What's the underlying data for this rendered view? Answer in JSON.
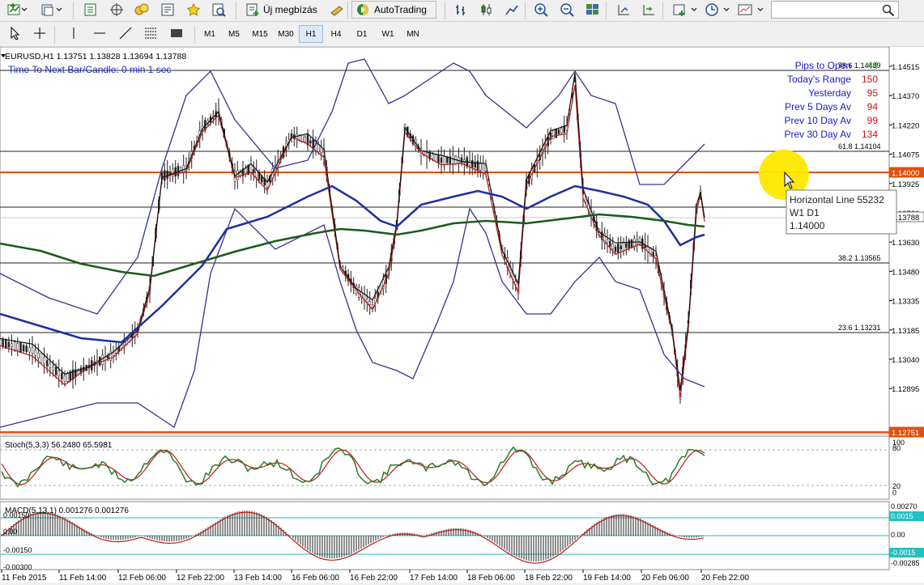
{
  "toolbar": {
    "new_order_label": "Új megbízás",
    "autotrading_label": "AutoTrading",
    "timeframes": [
      "M1",
      "M5",
      "M15",
      "M30",
      "H1",
      "H4",
      "D1",
      "W1",
      "MN"
    ],
    "active_timeframe": "H1"
  },
  "chart": {
    "header": "EURUSD,H1  1.13751 1.13828 1.13694 1.13788",
    "timer_text": "Time To Next Bar/Candle: 0 min 1 sec",
    "info_panel": [
      {
        "label": "Pips to Open",
        "value": "44"
      },
      {
        "label": "Today's Range",
        "value": "150"
      },
      {
        "label": "Yesterday",
        "value": "95"
      },
      {
        "label": "Prev 5 Days Av",
        "value": "94"
      },
      {
        "label": "Prev 10 Day Av",
        "value": "99"
      },
      {
        "label": "Prev 30 Day Av",
        "value": "134"
      }
    ],
    "fib_labels": [
      "78.6 1.14489",
      "61.8 1.14104",
      "38.2 1.13565",
      "23.6 1.13231"
    ],
    "price_ticks": [
      "1.14515",
      "1.14370",
      "1.14220",
      "1.14075",
      "1.13925",
      "1.13780",
      "1.13630",
      "1.13480",
      "1.13335",
      "1.13185",
      "1.13040",
      "1.12895"
    ],
    "price_tags": {
      "orange_top": "1.14000",
      "current": "1.13788",
      "orange_bottom": "1.12751"
    },
    "tooltip": [
      "Horizontal Line 55232",
      "W1 D1",
      "1.14000"
    ],
    "time_labels": [
      "11 Feb 2015",
      "11 Feb 14:00",
      "12 Feb 06:00",
      "12 Feb 22:00",
      "13 Feb 14:00",
      "16 Feb 06:00",
      "16 Feb 22:00",
      "17 Feb 14:00",
      "18 Feb 06:00",
      "18 Feb 22:00",
      "19 Feb 14:00",
      "20 Feb 06:00",
      "20 Feb 22:00"
    ]
  },
  "stoch": {
    "label": "Stoch(5,3,3) 56.2480 65.5981",
    "ticks": [
      "100",
      "80",
      "20",
      "0"
    ]
  },
  "macd": {
    "label": "MACD(5,13,1) 0.001276 0.001276",
    "left_ticks": [
      "0.00150",
      "0.00",
      "-0.00150",
      "-0.00300"
    ],
    "right_ticks": [
      "0.00270",
      "0.0015",
      "0.00",
      "-0.0015",
      "-0.00285"
    ]
  }
}
